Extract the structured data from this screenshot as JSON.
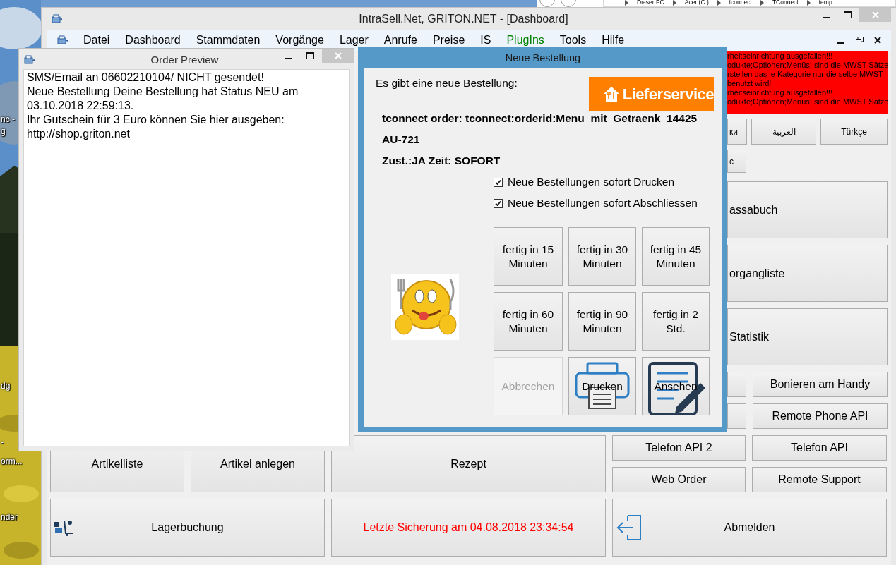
{
  "desktop": {
    "icon_labels": [
      "nc -",
      "g",
      "dg",
      "-",
      "orm...",
      "nder"
    ]
  },
  "explorer": {
    "breadcrumb": [
      "Dieser PC",
      "Acer (C:)",
      "tconnect",
      "TConnect",
      "temp"
    ]
  },
  "main_window": {
    "title": "IntraSell.Net, GRITON.NET - [Dashboard]",
    "menu": [
      {
        "label": "Datei",
        "color": "#000000"
      },
      {
        "label": "Dashboard",
        "color": "#000000"
      },
      {
        "label": "Stammdaten",
        "color": "#000000"
      },
      {
        "label": "Vorgänge",
        "color": "#000000"
      },
      {
        "label": "Lager",
        "color": "#000000"
      },
      {
        "label": "Anrufe",
        "color": "#000000"
      },
      {
        "label": "Preise",
        "color": "#000000"
      },
      {
        "label": "IS",
        "color": "#000000"
      },
      {
        "label": "PlugIns",
        "color": "#008000"
      },
      {
        "label": "Tools",
        "color": "#000000"
      },
      {
        "label": "Hilfe",
        "color": "#000000"
      }
    ],
    "dashboard": {
      "alert_lines": [
        "rheitseinrichtung ausgefallen!!!",
        "odukte;Optionen;Menüs; sind die MWST Sätze",
        "rstellen das je Kategorie nur die selbe MWST",
        "benutzt wird!",
        "rheitseinrichtung ausgefallen!!!",
        "odukte;Optionen;Menüs; sind die MWST Sätze"
      ],
      "language_buttons": [
        "ки",
        "العربية",
        "Türkçe"
      ],
      "language_buttons_row2": [
        "c"
      ],
      "big_buttons": [
        "assabuch",
        "organgliste",
        "Statistik"
      ],
      "side_buttons": [
        "Bonieren am Handy",
        "Remote Phone API"
      ],
      "tall_buttons": [
        "Artikelliste",
        "Artikel anlegen",
        "Rezept"
      ],
      "small_buttons": [
        "Telefon API 2",
        "Telefon API",
        "Web Order",
        "Remote Support"
      ],
      "bottom_row": [
        {
          "kind": "stock",
          "label": "Lagerbuchung"
        },
        {
          "kind": "notice",
          "label": "Letzte Sicherung am 04.08.2018 23:34:54"
        },
        {
          "kind": "logout",
          "label": "Abmelden"
        }
      ]
    }
  },
  "order_preview": {
    "title": "Order Preview",
    "lines": [
      "SMS/Email an 06602210104/ NICHT gesendet!",
      "Neue Bestellung Deine Bestellung hat Status NEU am",
      "03.10.2018 22:59:13.",
      "Ihr Gutschein für 3 Euro können Sie hier ausgeben:",
      "http://shop.griton.net"
    ]
  },
  "dialog": {
    "title": "Neue Bestellung",
    "intro": "Es gibt eine neue Bestellung:",
    "logo": "Lieferservice",
    "details": [
      "tconnect order: tconnect:orderid:Menu_mit_Getraenk_14425",
      "AU-721",
      "Zust.:JA Zeit: SOFORT"
    ],
    "options": [
      {
        "label": "Neue Bestellungen sofort Drucken",
        "checked": true
      },
      {
        "label": "Neue Bestellungen sofort Abschliessen",
        "checked": true
      }
    ],
    "buttons": [
      {
        "label": "fertig in 15 Minuten",
        "kind": "text",
        "disabled": false
      },
      {
        "label": "fertig in 30 Minuten",
        "kind": "text",
        "disabled": false
      },
      {
        "label": "fertig in 45 Minuten",
        "kind": "text",
        "disabled": false
      },
      {
        "label": "fertig in 60 Minuten",
        "kind": "text",
        "disabled": false
      },
      {
        "label": "fertig in 90 Minuten",
        "kind": "text",
        "disabled": false
      },
      {
        "label": "fertig in 2 Std.",
        "kind": "text",
        "disabled": false
      },
      {
        "label": "Abbrechen",
        "kind": "text",
        "disabled": true
      },
      {
        "label": "Drucken",
        "kind": "print",
        "disabled": false
      },
      {
        "label": "Ansehen",
        "kind": "view",
        "disabled": false
      }
    ]
  }
}
